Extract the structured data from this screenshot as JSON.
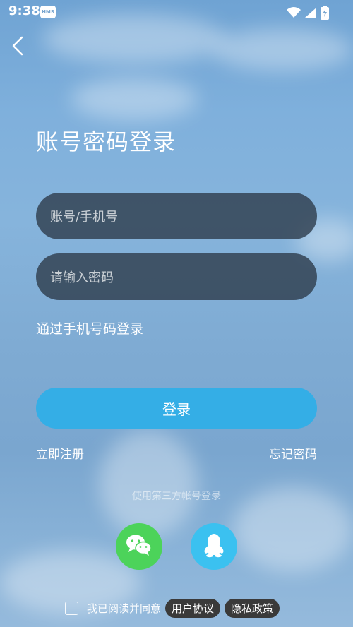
{
  "status_bar": {
    "time": "9:38",
    "hms_badge": "HMS",
    "icons": [
      "wifi-icon",
      "signal-icon",
      "battery-charging-icon"
    ]
  },
  "header": {
    "back_icon": "chevron-left-icon",
    "title": "账号密码登录"
  },
  "form": {
    "account_placeholder": "账号/手机号",
    "password_placeholder": "请输入密码",
    "phone_login_label": "通过手机号码登录",
    "login_button_label": "登录",
    "register_label": "立即注册",
    "forgot_label": "忘记密码"
  },
  "third_party": {
    "hint": "使用第三方帐号登录",
    "providers": [
      {
        "name": "wechat",
        "icon": "wechat-icon",
        "color": "#4cd35a"
      },
      {
        "name": "qq",
        "icon": "qq-penguin-icon",
        "color": "#3bc1f0"
      }
    ]
  },
  "agreement": {
    "text": "我已阅读并同意",
    "user_agreement": "用户协议",
    "privacy_policy": "隐私政策",
    "checked": false
  },
  "colors": {
    "accent": "#34aee6",
    "field_bg": "#2f3e4e"
  }
}
